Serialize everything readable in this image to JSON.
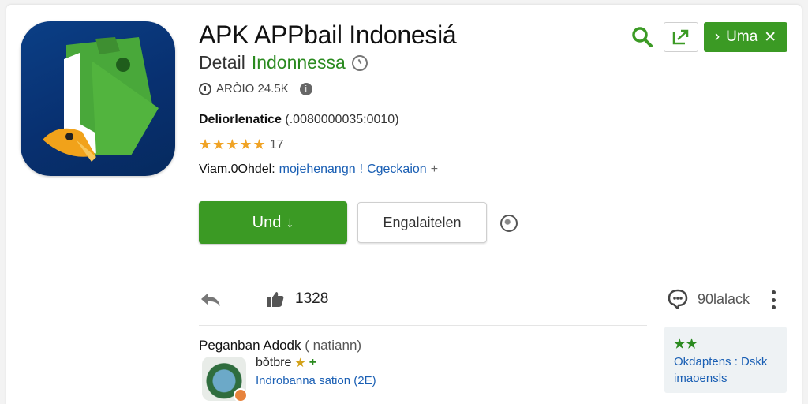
{
  "header": {
    "title": "APK APPbail Indonesiá",
    "subtitle_label": "Detail",
    "subtitle_link": "Indonnessa",
    "meta": "ARÒIO 24.5K",
    "info_badge": "i"
  },
  "developer": {
    "label": "Deliorlenatice",
    "code": "(.0080000035:0010)"
  },
  "rating": {
    "stars": "★★★★★",
    "count": "17"
  },
  "category": {
    "lead": "Viam.0Ohdel:",
    "items": [
      "mojehenangn",
      "Cgeckaion"
    ],
    "separator": "!",
    "plus": "+"
  },
  "actions": {
    "install_label": "Und",
    "install_arrow": "↓",
    "secondary_label": "Engalaitelen"
  },
  "top_bar": {
    "green_button_label": "Uma",
    "green_button_prefix": "›",
    "green_button_suffix": "✕"
  },
  "stats": {
    "like_count": "1328",
    "review_label": "90lalack"
  },
  "section": {
    "title": "Peganban Adodk",
    "title_suffix": "( natiann)",
    "item": {
      "name": "bǒtbre",
      "name_star": "★",
      "name_plus": "+",
      "sub": "Indrobanna sation (2E)"
    }
  },
  "side_card": {
    "stars": "★★",
    "line1": "Okdaptens : Dskk",
    "line2": "imaoensls"
  },
  "colors": {
    "brand_green": "#3b9a24",
    "link_blue": "#1a5fb4",
    "star_orange": "#f0a325",
    "icon_navy": "#083070"
  }
}
